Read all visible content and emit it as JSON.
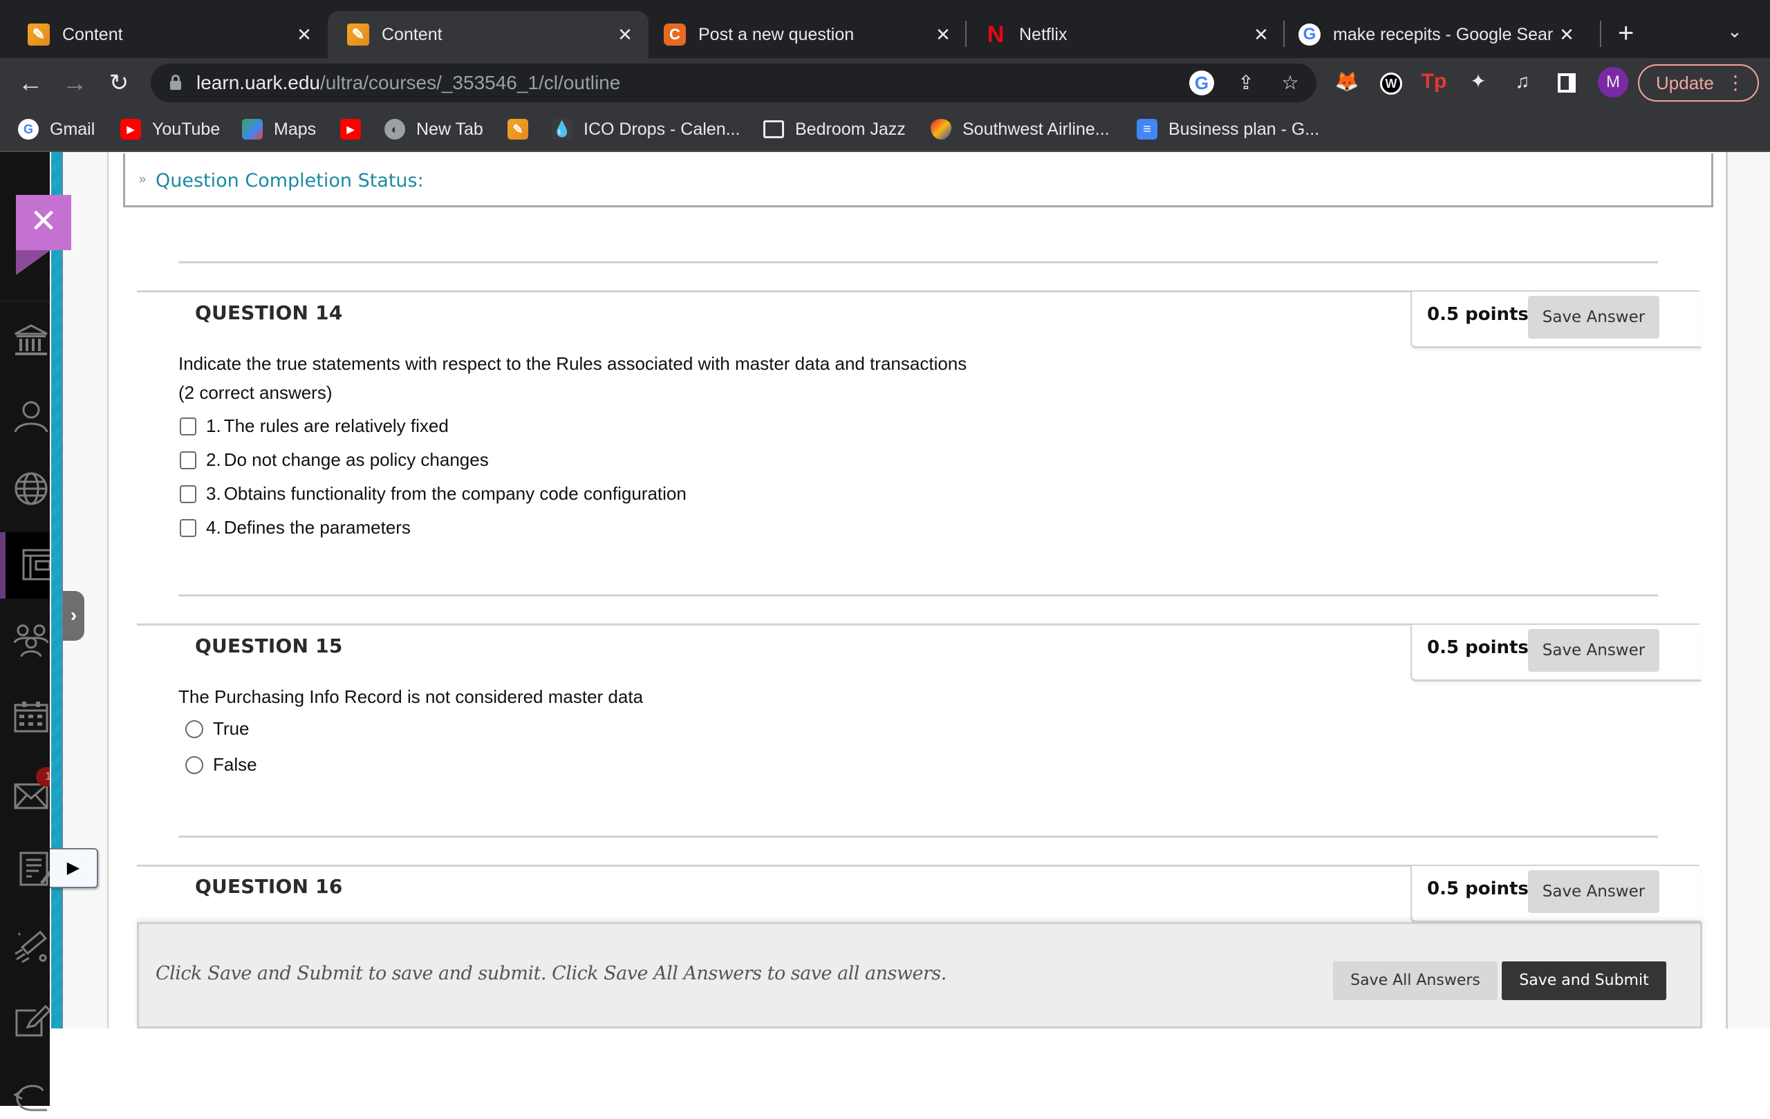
{
  "browser": {
    "tabs": [
      {
        "title": "Content",
        "icon": "pencil-icon",
        "active": false
      },
      {
        "title": "Content",
        "icon": "pencil-icon",
        "active": true
      },
      {
        "title": "Post a new question",
        "icon": "chegg-c-icon",
        "active": false
      },
      {
        "title": "Netflix",
        "icon": "netflix-n-icon",
        "active": false
      },
      {
        "title": "make recepits - Google Search",
        "icon": "google-icon",
        "active": false
      }
    ],
    "close_glyph": "✕",
    "new_tab_glyph": "+",
    "tab_search_glyph": "⌄",
    "url_host": "learn.uark.edu",
    "url_path": "/ultra/courses/_353546_1/cl/outline",
    "avatar_letter": "M",
    "update_label": "Update",
    "bookmarks": [
      {
        "label": "Gmail",
        "icon": "google-icon"
      },
      {
        "label": "YouTube",
        "icon": "youtube-icon"
      },
      {
        "label": "Maps",
        "icon": "maps-icon"
      },
      {
        "label": "",
        "icon": "youtube-icon"
      },
      {
        "label": "New Tab",
        "icon": "globe-icon"
      },
      {
        "label": "",
        "icon": "pencil-icon"
      },
      {
        "label": "ICO Drops - Calen...",
        "icon": "drop-icon"
      },
      {
        "label": "Bedroom Jazz",
        "icon": "folder-icon"
      },
      {
        "label": "Southwest Airline...",
        "icon": "heart-icon"
      },
      {
        "label": "Business plan - G...",
        "icon": "docs-icon"
      }
    ]
  },
  "lms": {
    "rail_icons": [
      "institution-icon",
      "profile-icon",
      "globe-icon",
      "courses-icon",
      "groups-icon",
      "calendar-icon",
      "messages-icon",
      "grades-icon",
      "tools-icon",
      "edit-icon",
      "sign-out-icon"
    ],
    "messages_badge": "1",
    "completion_status_label": "Question Completion Status:",
    "questions": [
      {
        "title": "QUESTION 14",
        "points": "0.5 points",
        "save_label": "Save Answer",
        "text": "Indicate the true statements with respect to the Rules associated with master data and transactions",
        "subtext": "(2 correct  answers)",
        "type": "checkbox",
        "options": [
          {
            "num": "1.",
            "label": "The rules are relatively fixed",
            "checked": false
          },
          {
            "num": "2.",
            "label": "Do not change as policy changes",
            "checked": false
          },
          {
            "num": "3.",
            "label": "Obtains functionality from the company code configuration",
            "checked": false
          },
          {
            "num": "4.",
            "label": "Defines the parameters",
            "checked": false
          }
        ]
      },
      {
        "title": "QUESTION 15",
        "points": "0.5 points",
        "save_label": "Save Answer",
        "text": "The Purchasing Info Record is not considered master data",
        "type": "radio",
        "options": [
          {
            "label": "True",
            "checked": false
          },
          {
            "label": "False",
            "checked": false
          }
        ]
      },
      {
        "title": "QUESTION 16",
        "points": "0.5 points",
        "save_label": "Save Answer"
      }
    ],
    "submit_message": "Click Save and Submit to save and submit. Click Save All Answers to save all answers.",
    "save_all_label": "Save All Answers",
    "save_submit_label": "Save and Submit"
  }
}
